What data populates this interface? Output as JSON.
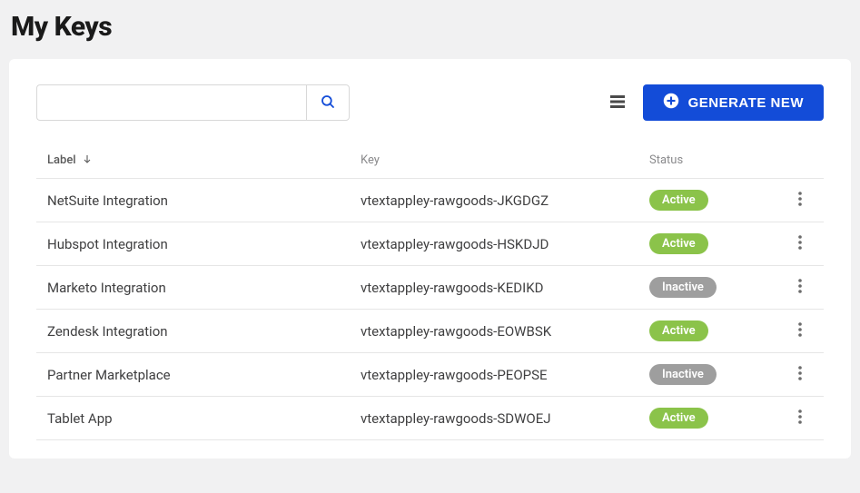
{
  "title": "My Keys",
  "toolbar": {
    "search_placeholder": "",
    "generate_label": "GENERATE NEW"
  },
  "columns": {
    "label": "Label",
    "key": "Key",
    "status": "Status"
  },
  "status_labels": {
    "active": "Active",
    "inactive": "Inactive"
  },
  "rows": [
    {
      "label": "NetSuite Integration",
      "key": "vtextappley-rawgoods-JKGDGZ",
      "status": "active"
    },
    {
      "label": "Hubspot Integration",
      "key": "vtextappley-rawgoods-HSKDJD",
      "status": "active"
    },
    {
      "label": "Marketo Integration",
      "key": "vtextappley-rawgoods-KEDIKD",
      "status": "inactive"
    },
    {
      "label": "Zendesk Integration",
      "key": "vtextappley-rawgoods-EOWBSK",
      "status": "active"
    },
    {
      "label": "Partner Marketplace",
      "key": "vtextappley-rawgoods-PEOPSE",
      "status": "inactive"
    },
    {
      "label": "Tablet App",
      "key": "vtextappley-rawgoods-SDWOEJ",
      "status": "active"
    }
  ]
}
